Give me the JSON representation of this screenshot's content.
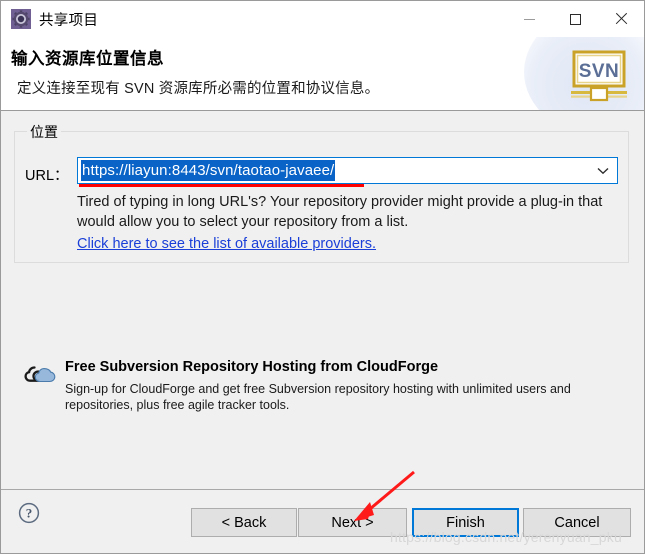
{
  "window": {
    "title": "共享项目",
    "app_icon": "gear-icon",
    "controls": {
      "minimize": "minimize-icon",
      "maximize": "maximize-icon",
      "close": "close-icon"
    }
  },
  "header": {
    "title": "输入资源库位置信息",
    "description": "定义连接至现有 SVN 资源库所必需的位置和协议信息。",
    "logo_text": "SVN",
    "logo_name": "svn-banner-logo"
  },
  "location_group": {
    "legend": "位置",
    "url_label": "URL：",
    "url_value": "https://liayun:8443/svn/taotao-javaee/",
    "url_placeholder": "",
    "combo_arrow_icon": "chevron-down-icon",
    "hint": "Tired of typing in long URL's?  Your repository provider might provide a plug-in that would allow you to select your repository from a list.",
    "providers_link": "Click here to see the list of available providers."
  },
  "cloudforge": {
    "icon": "cloud-icon",
    "title": "Free Subversion Repository Hosting from CloudForge",
    "body": "Sign-up for CloudForge and get free Subversion repository hosting with unlimited users and repositories, plus free agile tracker tools."
  },
  "annotations": {
    "arrow_color": "#ff1a1a",
    "underline_color": "#ff0000"
  },
  "buttonbar": {
    "help_icon": "help-question-icon",
    "back": "< Back",
    "next": "Next >",
    "finish": "Finish",
    "cancel": "Cancel"
  },
  "watermark": {
    "text": "https://blog.csdn.net/yerenyuan_pku"
  },
  "colors": {
    "accent": "#0078d7",
    "selection": "#0a64c8",
    "link": "#1a3fd8",
    "dialog_bg": "#f0f0f0",
    "header_bg": "#ffffff",
    "annotation_red": "#ff0000"
  }
}
